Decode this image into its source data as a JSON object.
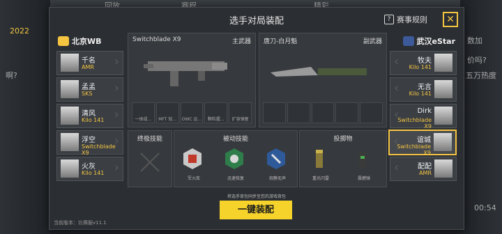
{
  "background": {
    "left_texts": [
      "2022",
      "啊?"
    ],
    "right_texts": [
      "00:54"
    ],
    "top_tabs": [
      "回放",
      "赛程",
      "精彩"
    ],
    "right_notes": [
      "数加",
      "价吗?",
      "五万热度"
    ]
  },
  "modal": {
    "title": "选手对局装配",
    "rules_label": "赛事规则",
    "rules_icon": "question-icon",
    "close_icon": "close-icon"
  },
  "teams": {
    "left": {
      "name": "北京WB",
      "players": [
        {
          "name": "千名",
          "weapon": "AMR"
        },
        {
          "name": "孟孟",
          "weapon": "SKS"
        },
        {
          "name": "清风",
          "weapon": "Kilo 141"
        },
        {
          "name": "浮空",
          "weapon": "Switchblade X9"
        },
        {
          "name": "火灰",
          "weapon": "Kilo 141"
        }
      ]
    },
    "right": {
      "name": "武汉eStar",
      "players": [
        {
          "name": "牧夫",
          "weapon": "Kilo 141"
        },
        {
          "name": "无言",
          "weapon": "Kilo 141"
        },
        {
          "name": "Dirk",
          "weapon": "Switchblade X9"
        },
        {
          "name": "谊城",
          "weapon": "Switchblade X9",
          "selected": true
        },
        {
          "name": "配配",
          "weapon": "AMR"
        }
      ]
    }
  },
  "primary": {
    "weapon_name": "Switchblade X9",
    "slot_label": "主武器",
    "attachments": [
      "一体成...",
      "MFT 轻...",
      "OWC 远...",
      "颗粒握...",
      "扩容弹匣"
    ]
  },
  "secondary": {
    "weapon_name": "唐刀-白月魁",
    "slot_label": "副武器"
  },
  "ultimate": {
    "title": "终极技能"
  },
  "passive": {
    "title": "被动技能",
    "skills": [
      "军火库",
      "迅速恢复",
      "寂静无声"
    ]
  },
  "throwables": {
    "title": "投掷物",
    "items": [
      "重光闪雷",
      "震撼弹"
    ]
  },
  "equip": {
    "hint": "将选手背包同步至您的游戏背包",
    "button_label": "一键装配"
  },
  "version": "当前版本：比赛服v11.1",
  "colors": {
    "accent": "#f5d32b",
    "gold": "#f5c542",
    "panel": "#36393d"
  }
}
